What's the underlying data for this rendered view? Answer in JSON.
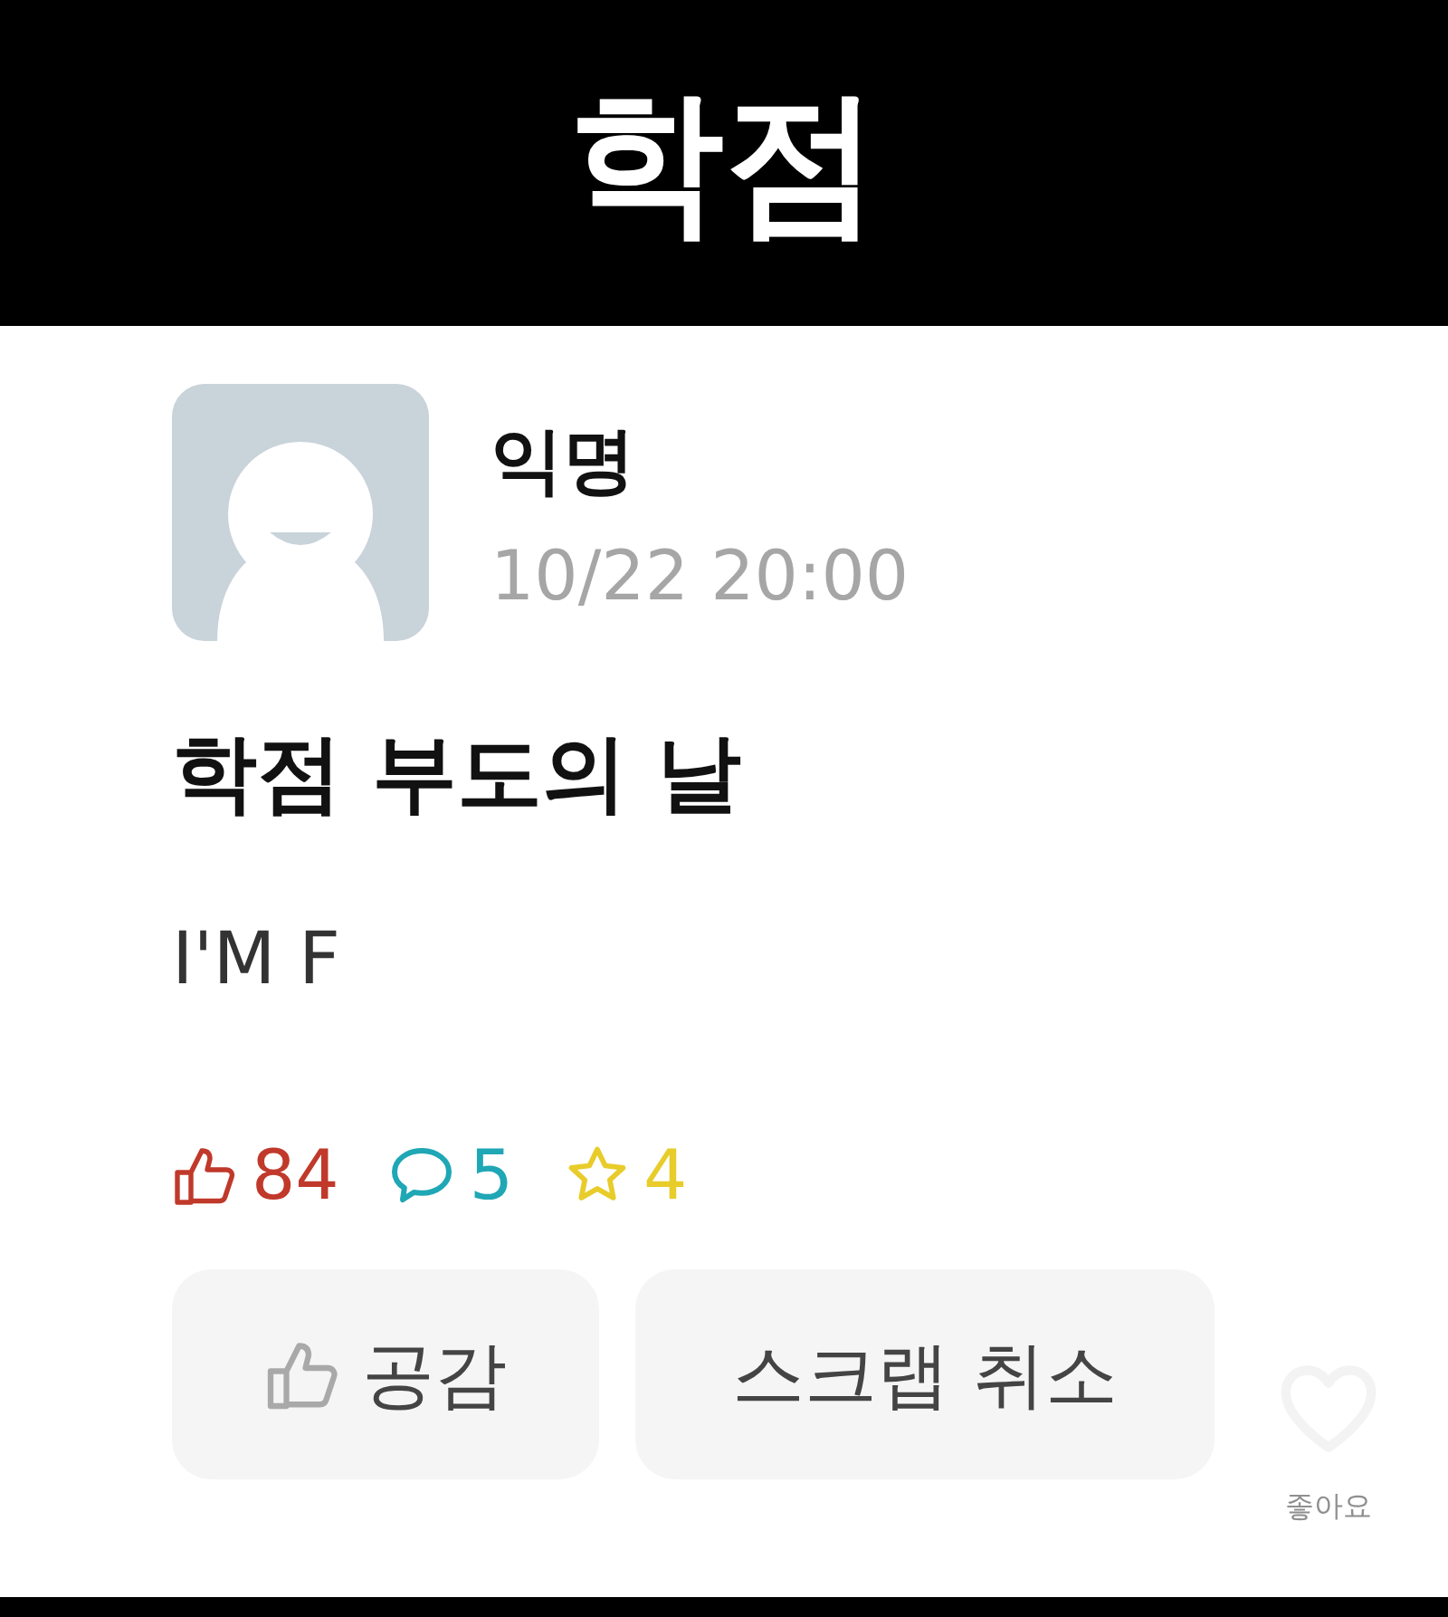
{
  "caption": "학점",
  "post": {
    "author": "익명",
    "time": "10/22 20:00",
    "title": "학점 부도의 날",
    "body": "I'M F",
    "stats": [
      {
        "kind": "like",
        "count": "84",
        "color": "#c0392b"
      },
      {
        "kind": "comment",
        "count": "5",
        "color": "#1fa7b5"
      },
      {
        "kind": "scrap",
        "count": "4",
        "color": "#e8cc2a"
      }
    ],
    "buttons": [
      {
        "kind": "like",
        "label": "공감"
      },
      {
        "kind": "plain",
        "label": "스크랩 취소"
      }
    ]
  },
  "overlay": {
    "label": "좋아요"
  }
}
